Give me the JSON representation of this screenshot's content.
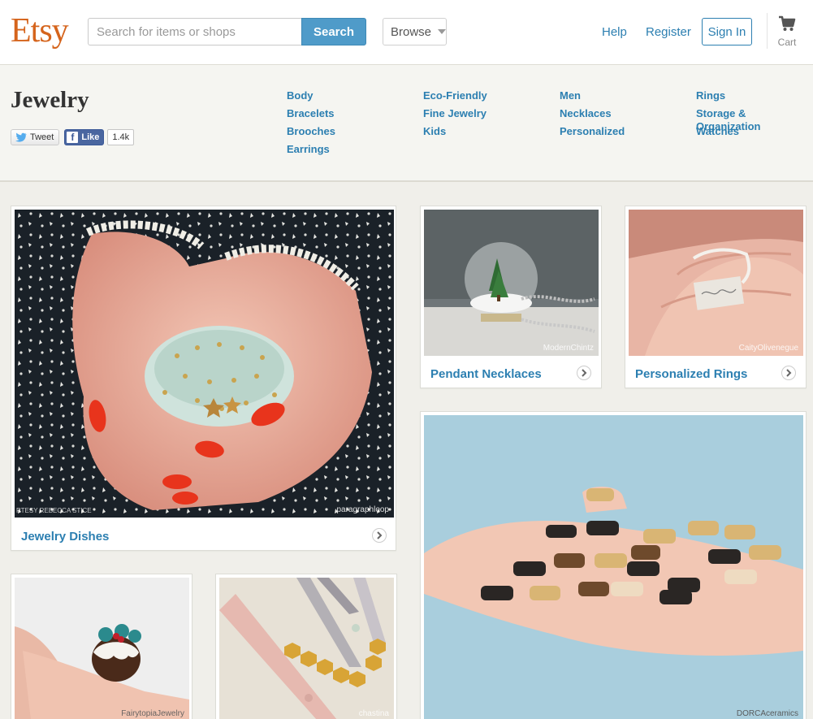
{
  "header": {
    "logo": "Etsy",
    "search": {
      "placeholder": "Search for items or shops",
      "button_label": "Search"
    },
    "browse_label": "Browse",
    "help_label": "Help",
    "register_label": "Register",
    "signin_label": "Sign In",
    "cart_label": "Cart",
    "colors": {
      "brand": "#d5641c",
      "accent": "#2c7fb1",
      "search_button": "#4f9bc9"
    }
  },
  "category": {
    "title": "Jewelry",
    "tweet_label": "Tweet",
    "like_label": "Like",
    "like_count": "1.4k",
    "links": [
      [
        "Body",
        "Bracelets",
        "Brooches",
        "Earrings"
      ],
      [
        "Eco-Friendly",
        "Fine Jewelry",
        "Kids"
      ],
      [
        "Men",
        "Necklaces",
        "Personalized"
      ],
      [
        "Rings",
        "Storage & Organization",
        "Watches"
      ]
    ]
  },
  "tiles": {
    "jewelry_dishes": {
      "label": "Jewelry Dishes",
      "shop": "paragraphloop",
      "watermark": "RTESY REBECCA STICE"
    },
    "pendant_necklaces": {
      "label": "Pendant Necklaces",
      "shop": "ModernChintz"
    },
    "personalized_rings": {
      "label": "Personalized Rings",
      "shop": "CaityOlivenegue"
    },
    "pudding": {
      "shop": "FairytopiaJewelry"
    },
    "necklace_strips": {
      "shop": "chastina"
    },
    "dogs": {
      "shop": "DORCAceramics"
    }
  }
}
